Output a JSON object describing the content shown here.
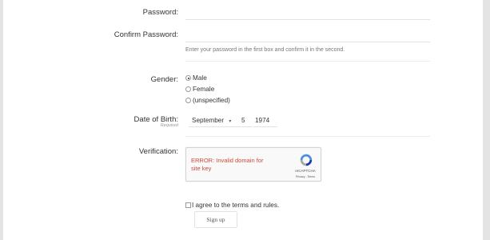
{
  "form": {
    "password": {
      "label": "Password:",
      "value": ""
    },
    "confirm_password": {
      "label": "Confirm Password:",
      "value": "",
      "hint": "Enter your password in the first box and confirm it in the second."
    },
    "gender": {
      "label": "Gender:",
      "options": [
        "Male",
        "Female",
        "(unspecified)"
      ],
      "selected": "Male"
    },
    "dob": {
      "label": "Date of Birth:",
      "sublabel": "Required",
      "month": "September",
      "month_arrow": "▾",
      "day": "5",
      "year": "1974"
    },
    "verification": {
      "label": "Verification:",
      "error": "ERROR: Invalid domain for site key",
      "brand": "reCAPTCHA",
      "links": "Privacy - Terms"
    },
    "agree": {
      "label": "I agree to the terms and rules.",
      "checked": false
    },
    "submit": {
      "label": "Sign up"
    }
  },
  "colors": {
    "error": "#d14836",
    "frame": "#e4e4e4",
    "recaptcha_blue": "#4a90e2",
    "recaptcha_dark": "#1c3aa9"
  }
}
